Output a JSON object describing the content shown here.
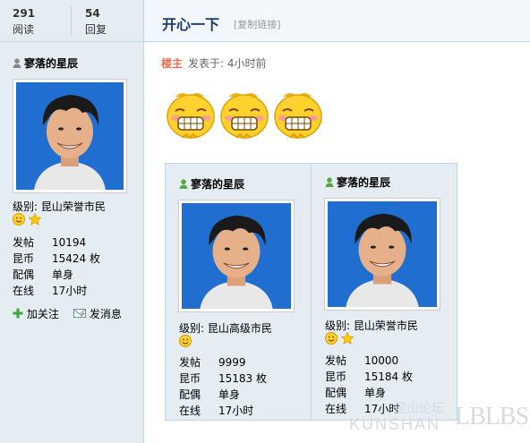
{
  "stats": {
    "views_num": "291",
    "views_label": "阅读",
    "replies_num": "54",
    "replies_label": "回复"
  },
  "thread": {
    "title": "开心一下",
    "copy_link": "[复制链接]"
  },
  "post": {
    "louzhu": "楼主",
    "posted_at": "发表于: 4小时前"
  },
  "author": {
    "name": "寥落的星辰",
    "level": "级别: 昆山荣誉市民",
    "rows": [
      {
        "k": "发帖",
        "v": "10194"
      },
      {
        "k": "昆币",
        "v": "15424 枚"
      },
      {
        "k": "配偶",
        "v": "单身"
      },
      {
        "k": "在线",
        "v": "17小时"
      }
    ],
    "add_follow": "加关注",
    "send_msg": "发消息"
  },
  "card1": {
    "name": "寥落的星辰",
    "level": "级别: 昆山高级市民",
    "rows": [
      {
        "k": "发帖",
        "v": "9999"
      },
      {
        "k": "昆币",
        "v": "15183 枚"
      },
      {
        "k": "配偶",
        "v": "单身"
      },
      {
        "k": "在线",
        "v": "17小时"
      }
    ]
  },
  "card2": {
    "name": "寥落的星辰",
    "level": "级别: 昆山荣誉市民",
    "rows": [
      {
        "k": "发帖",
        "v": "10000"
      },
      {
        "k": "昆币",
        "v": "15184 枚"
      },
      {
        "k": "配偶",
        "v": "单身"
      },
      {
        "k": "在线",
        "v": "17小时"
      }
    ]
  },
  "watermark": {
    "text": "KUNSHAN",
    "cn": "昆山论坛",
    "mark": "LBLBS"
  },
  "colors": {
    "sidebar_bg": "#e5edf2",
    "border": "#c2d5e3",
    "title": "#1c3b6e",
    "louzhu": "#f26c4f",
    "avatar_bg": "#1f6ed0"
  },
  "icons": [
    "user-icon",
    "smile-icon",
    "star-icon",
    "add-icon",
    "message-icon",
    "grin-emoji"
  ]
}
